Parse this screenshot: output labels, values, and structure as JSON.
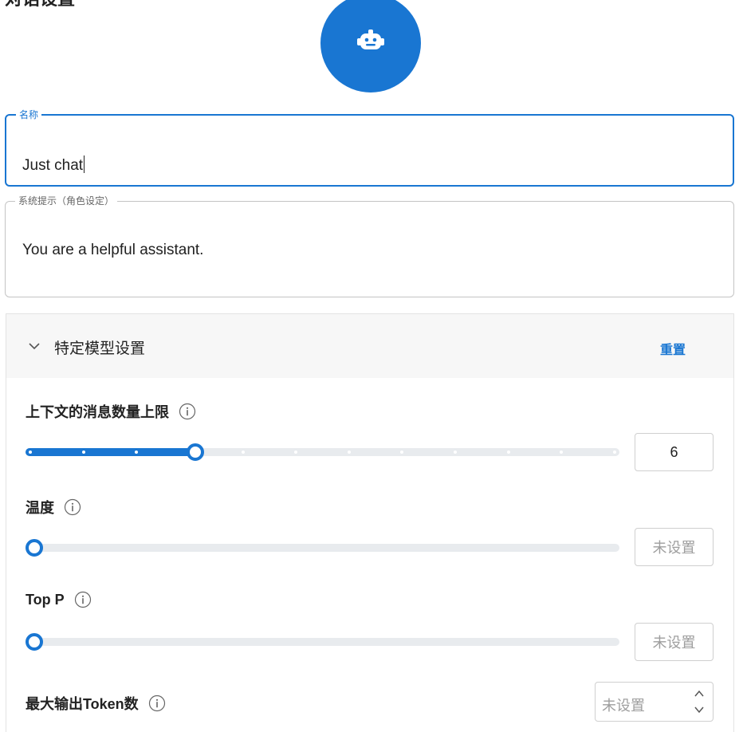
{
  "page": {
    "title": "对话设置"
  },
  "name_field": {
    "label": "名称",
    "value": "Just chat"
  },
  "prompt_field": {
    "label": "系统提示（角色设定）",
    "value": "You are a helpful assistant."
  },
  "model_settings": {
    "title": "特定模型设置",
    "reset_label": "重置",
    "context_limit": {
      "label": "上下文的消息数量上限",
      "value": "6",
      "slider_fraction": 0.28
    },
    "temperature": {
      "label": "温度",
      "value": "未设置",
      "slider_fraction": 0
    },
    "top_p": {
      "label": "Top P",
      "value": "未设置",
      "slider_fraction": 0
    },
    "max_tokens": {
      "label": "最大输出Token数",
      "placeholder": "未设置"
    }
  },
  "colors": {
    "accent": "#1976d2",
    "track": "#e8ebee",
    "header_bg": "#f7f7f7"
  },
  "icons": [
    "robot-icon",
    "chevron-down-icon",
    "info-icon",
    "chevron-up-icon"
  ]
}
